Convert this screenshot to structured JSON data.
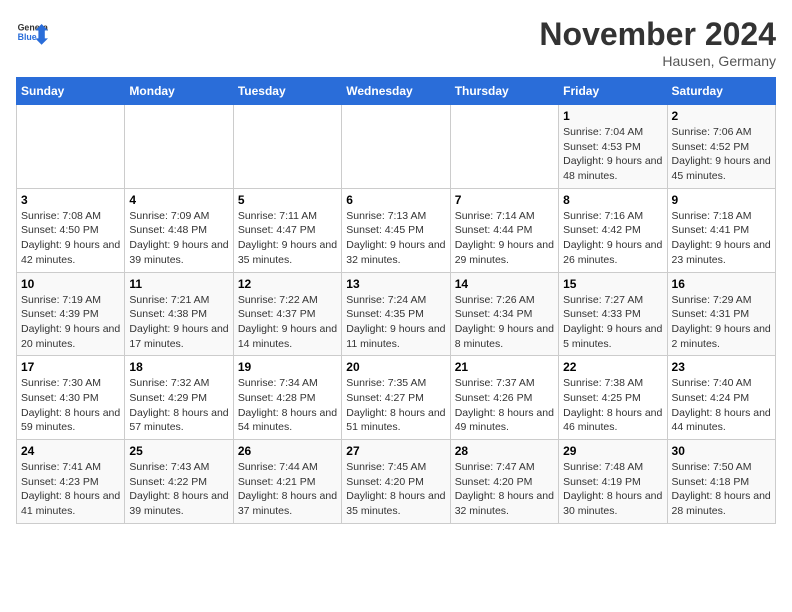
{
  "header": {
    "logo_general": "General",
    "logo_blue": "Blue",
    "month_title": "November 2024",
    "location": "Hausen, Germany"
  },
  "weekdays": [
    "Sunday",
    "Monday",
    "Tuesday",
    "Wednesday",
    "Thursday",
    "Friday",
    "Saturday"
  ],
  "weeks": [
    [
      {
        "day": "",
        "info": ""
      },
      {
        "day": "",
        "info": ""
      },
      {
        "day": "",
        "info": ""
      },
      {
        "day": "",
        "info": ""
      },
      {
        "day": "",
        "info": ""
      },
      {
        "day": "1",
        "info": "Sunrise: 7:04 AM\nSunset: 4:53 PM\nDaylight: 9 hours and 48 minutes."
      },
      {
        "day": "2",
        "info": "Sunrise: 7:06 AM\nSunset: 4:52 PM\nDaylight: 9 hours and 45 minutes."
      }
    ],
    [
      {
        "day": "3",
        "info": "Sunrise: 7:08 AM\nSunset: 4:50 PM\nDaylight: 9 hours and 42 minutes."
      },
      {
        "day": "4",
        "info": "Sunrise: 7:09 AM\nSunset: 4:48 PM\nDaylight: 9 hours and 39 minutes."
      },
      {
        "day": "5",
        "info": "Sunrise: 7:11 AM\nSunset: 4:47 PM\nDaylight: 9 hours and 35 minutes."
      },
      {
        "day": "6",
        "info": "Sunrise: 7:13 AM\nSunset: 4:45 PM\nDaylight: 9 hours and 32 minutes."
      },
      {
        "day": "7",
        "info": "Sunrise: 7:14 AM\nSunset: 4:44 PM\nDaylight: 9 hours and 29 minutes."
      },
      {
        "day": "8",
        "info": "Sunrise: 7:16 AM\nSunset: 4:42 PM\nDaylight: 9 hours and 26 minutes."
      },
      {
        "day": "9",
        "info": "Sunrise: 7:18 AM\nSunset: 4:41 PM\nDaylight: 9 hours and 23 minutes."
      }
    ],
    [
      {
        "day": "10",
        "info": "Sunrise: 7:19 AM\nSunset: 4:39 PM\nDaylight: 9 hours and 20 minutes."
      },
      {
        "day": "11",
        "info": "Sunrise: 7:21 AM\nSunset: 4:38 PM\nDaylight: 9 hours and 17 minutes."
      },
      {
        "day": "12",
        "info": "Sunrise: 7:22 AM\nSunset: 4:37 PM\nDaylight: 9 hours and 14 minutes."
      },
      {
        "day": "13",
        "info": "Sunrise: 7:24 AM\nSunset: 4:35 PM\nDaylight: 9 hours and 11 minutes."
      },
      {
        "day": "14",
        "info": "Sunrise: 7:26 AM\nSunset: 4:34 PM\nDaylight: 9 hours and 8 minutes."
      },
      {
        "day": "15",
        "info": "Sunrise: 7:27 AM\nSunset: 4:33 PM\nDaylight: 9 hours and 5 minutes."
      },
      {
        "day": "16",
        "info": "Sunrise: 7:29 AM\nSunset: 4:31 PM\nDaylight: 9 hours and 2 minutes."
      }
    ],
    [
      {
        "day": "17",
        "info": "Sunrise: 7:30 AM\nSunset: 4:30 PM\nDaylight: 8 hours and 59 minutes."
      },
      {
        "day": "18",
        "info": "Sunrise: 7:32 AM\nSunset: 4:29 PM\nDaylight: 8 hours and 57 minutes."
      },
      {
        "day": "19",
        "info": "Sunrise: 7:34 AM\nSunset: 4:28 PM\nDaylight: 8 hours and 54 minutes."
      },
      {
        "day": "20",
        "info": "Sunrise: 7:35 AM\nSunset: 4:27 PM\nDaylight: 8 hours and 51 minutes."
      },
      {
        "day": "21",
        "info": "Sunrise: 7:37 AM\nSunset: 4:26 PM\nDaylight: 8 hours and 49 minutes."
      },
      {
        "day": "22",
        "info": "Sunrise: 7:38 AM\nSunset: 4:25 PM\nDaylight: 8 hours and 46 minutes."
      },
      {
        "day": "23",
        "info": "Sunrise: 7:40 AM\nSunset: 4:24 PM\nDaylight: 8 hours and 44 minutes."
      }
    ],
    [
      {
        "day": "24",
        "info": "Sunrise: 7:41 AM\nSunset: 4:23 PM\nDaylight: 8 hours and 41 minutes."
      },
      {
        "day": "25",
        "info": "Sunrise: 7:43 AM\nSunset: 4:22 PM\nDaylight: 8 hours and 39 minutes."
      },
      {
        "day": "26",
        "info": "Sunrise: 7:44 AM\nSunset: 4:21 PM\nDaylight: 8 hours and 37 minutes."
      },
      {
        "day": "27",
        "info": "Sunrise: 7:45 AM\nSunset: 4:20 PM\nDaylight: 8 hours and 35 minutes."
      },
      {
        "day": "28",
        "info": "Sunrise: 7:47 AM\nSunset: 4:20 PM\nDaylight: 8 hours and 32 minutes."
      },
      {
        "day": "29",
        "info": "Sunrise: 7:48 AM\nSunset: 4:19 PM\nDaylight: 8 hours and 30 minutes."
      },
      {
        "day": "30",
        "info": "Sunrise: 7:50 AM\nSunset: 4:18 PM\nDaylight: 8 hours and 28 minutes."
      }
    ]
  ]
}
